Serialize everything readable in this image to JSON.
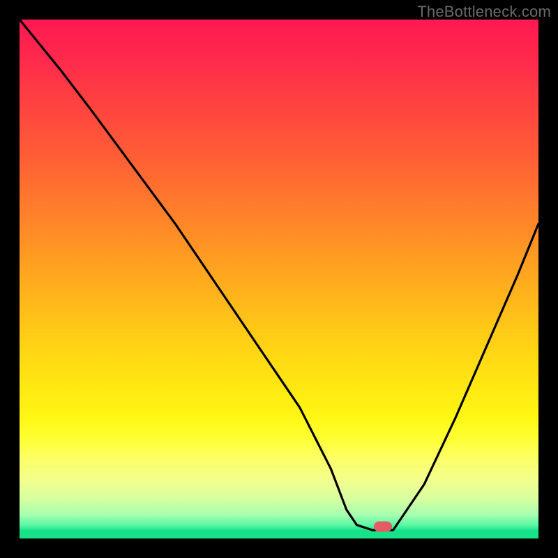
{
  "watermark": "TheBottleneck.com",
  "colors": {
    "background": "#000000",
    "curve": "#000000",
    "marker": "#e55b63",
    "baseline": "#17e189"
  },
  "chart_data": {
    "type": "line",
    "title": "",
    "xlabel": "",
    "ylabel": "",
    "xlim": [
      0,
      100
    ],
    "ylim": [
      0,
      100
    ],
    "series": [
      {
        "name": "bottleneck-curve",
        "x": [
          0,
          8,
          14,
          22,
          30,
          38,
          46,
          54,
          60,
          63,
          65,
          68,
          72,
          78,
          84,
          90,
          96,
          100
        ],
        "y": [
          100,
          90,
          82,
          71,
          60,
          48,
          36,
          24,
          12,
          4,
          1,
          0,
          0,
          9,
          22,
          36,
          50,
          60
        ]
      }
    ],
    "marker": {
      "x": 70,
      "y": 0.7
    },
    "gradient_stops": [
      {
        "pos": 0,
        "color": "#ff1951"
      },
      {
        "pos": 50,
        "color": "#ffb41e"
      },
      {
        "pos": 82,
        "color": "#ffff33"
      },
      {
        "pos": 100,
        "color": "#1be78e"
      }
    ]
  }
}
